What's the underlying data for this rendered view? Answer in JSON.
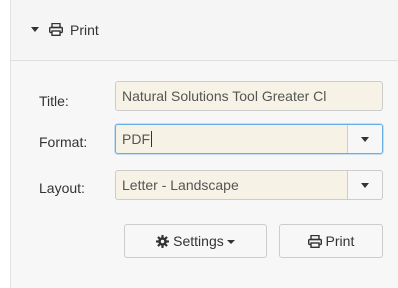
{
  "panel": {
    "title": "Print",
    "icons": {
      "collapse": "caret-down-icon",
      "print": "printer-icon"
    }
  },
  "form": {
    "title_label": "Title:",
    "title_value": "Natural Solutions Tool Greater Cl",
    "format_label": "Format:",
    "format_value": "PDF",
    "layout_label": "Layout:",
    "layout_value": "Letter - Landscape"
  },
  "buttons": {
    "settings_label": "Settings",
    "settings_icon": "gear-icon",
    "print_label": "Print",
    "print_icon": "printer-icon"
  },
  "colors": {
    "field_bg": "#f7f2e6",
    "focus_border": "#66afe9"
  }
}
